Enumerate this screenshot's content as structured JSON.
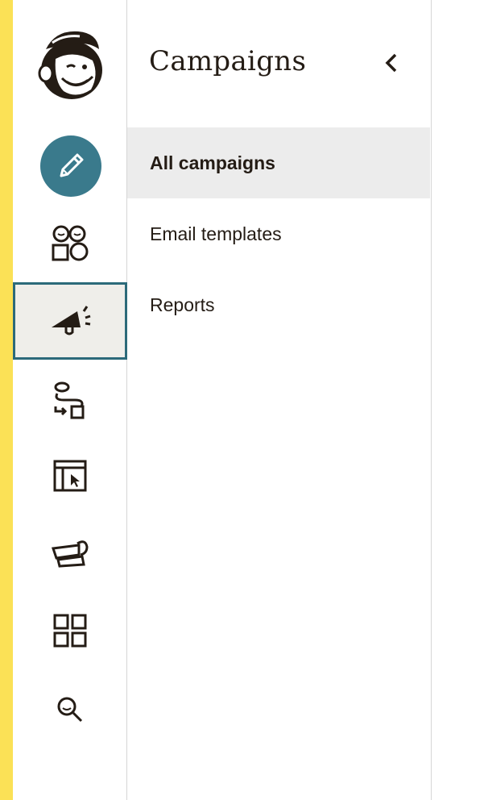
{
  "panel": {
    "title": "Campaigns",
    "menu": [
      {
        "label": "All campaigns",
        "active": true
      },
      {
        "label": "Email templates",
        "active": false
      },
      {
        "label": "Reports",
        "active": false
      }
    ]
  },
  "rail": {
    "icons": [
      "freddie-logo",
      "pencil-icon",
      "audience-icon",
      "megaphone-icon",
      "automation-flow-icon",
      "website-cursor-icon",
      "content-studio-icon",
      "integrations-grid-icon",
      "search-icon"
    ],
    "active": "campaigns"
  },
  "colors": {
    "accent_strip": "#fbe156",
    "create_button": "#3a7a8c",
    "active_border": "#2c6a7a",
    "active_bg": "#efeeea",
    "menu_active_bg": "#ececec"
  }
}
